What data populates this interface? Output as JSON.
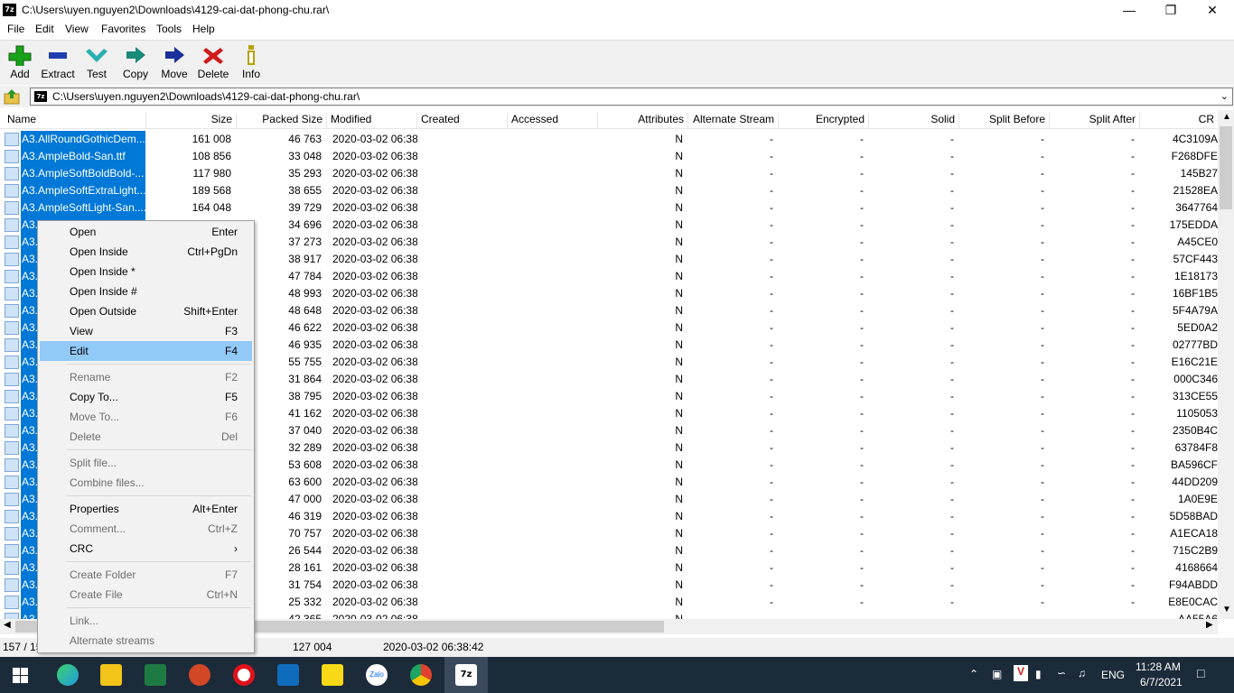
{
  "window": {
    "title": "C:\\Users\\uyen.nguyen2\\Downloads\\4129-cai-dat-phong-chu.rar\\",
    "app_icon": "7z",
    "minimize": "—",
    "maximize": "❐",
    "close": "✕"
  },
  "menu": [
    "File",
    "Edit",
    "View",
    "Favorites",
    "Tools",
    "Help"
  ],
  "toolbar": [
    {
      "label": "Add",
      "icon": "plus-icon",
      "color": "#1ba21b"
    },
    {
      "label": "Extract",
      "icon": "minus-icon",
      "color": "#1f3fb0"
    },
    {
      "label": "Test",
      "icon": "check-icon",
      "color": "#2ab0b0"
    },
    {
      "label": "Copy",
      "icon": "arrow-right-icon",
      "color": "#1a8a7a"
    },
    {
      "label": "Move",
      "icon": "arrow-right-icon",
      "color": "#1a2f9c"
    },
    {
      "label": "Delete",
      "icon": "x-icon",
      "color": "#d01a1a"
    },
    {
      "label": "Info",
      "icon": "info-icon",
      "color": "#b8a000"
    }
  ],
  "address": {
    "path": "C:\\Users\\uyen.nguyen2\\Downloads\\4129-cai-dat-phong-chu.rar\\",
    "icon": "7z"
  },
  "columns": [
    "Name",
    "Size",
    "Packed Size",
    "Modified",
    "Created",
    "Accessed",
    "Attributes",
    "Alternate Stream",
    "Encrypted",
    "Solid",
    "Split Before",
    "Split After",
    "CR"
  ],
  "rows": [
    {
      "name": "A3.AllRoundGothicDem...",
      "size": "161 008",
      "packed": "46 763",
      "crc": "4C3109A",
      "selected": true
    },
    {
      "name": "A3.AmpleBold-San.ttf",
      "size": "108 856",
      "packed": "33 048",
      "crc": "F268DFE",
      "selected": true
    },
    {
      "name": "A3.AmpleSoftBoldBold-...",
      "size": "117 980",
      "packed": "35 293",
      "crc": "145B27",
      "selected": true
    },
    {
      "name": "A3.AmpleSoftExtraLight...",
      "size": "189 568",
      "packed": "38 655",
      "crc": "21528EA",
      "selected": true
    },
    {
      "name": "A3.AmpleSoftLight-San....",
      "size": "164 048",
      "packed": "39 729",
      "crc": "3647764",
      "selected": true
    },
    {
      "name": "A3.",
      "size": "",
      "packed": "34 696",
      "crc": "175EDDA",
      "selected": true
    },
    {
      "name": "A3.",
      "size": "",
      "packed": "37 273",
      "crc": "A45CE0",
      "selected": true
    },
    {
      "name": "A3.",
      "size": "",
      "packed": "38 917",
      "crc": "57CF443",
      "selected": true
    },
    {
      "name": "A3.",
      "size": "",
      "packed": "47 784",
      "crc": "1E18173",
      "selected": true
    },
    {
      "name": "A3.",
      "size": "",
      "packed": "48 993",
      "crc": "16BF1B5",
      "selected": true
    },
    {
      "name": "A3.",
      "size": "",
      "packed": "48 648",
      "crc": "5F4A79A",
      "selected": true
    },
    {
      "name": "A3.",
      "size": "",
      "packed": "46 622",
      "crc": "5ED0A2",
      "selected": true
    },
    {
      "name": "A3.",
      "size": "",
      "packed": "46 935",
      "crc": "02777BD",
      "selected": true
    },
    {
      "name": "A3.",
      "size": "",
      "packed": "55 755",
      "crc": "E16C21E",
      "selected": true
    },
    {
      "name": "A3.",
      "size": "",
      "packed": "31 864",
      "crc": "000C346",
      "selected": true
    },
    {
      "name": "A3.",
      "size": "",
      "packed": "38 795",
      "crc": "313CE55",
      "selected": true
    },
    {
      "name": "A3.",
      "size": "",
      "packed": "41 162",
      "crc": "1105053",
      "selected": true
    },
    {
      "name": "A3.",
      "size": "",
      "packed": "37 040",
      "crc": "2350B4C",
      "selected": true
    },
    {
      "name": "A3.",
      "size": "",
      "packed": "32 289",
      "crc": "63784F8",
      "selected": true
    },
    {
      "name": "A3.",
      "size": "",
      "packed": "53 608",
      "crc": "BA596CF",
      "selected": true
    },
    {
      "name": "A3.",
      "size": "",
      "packed": "63 600",
      "crc": "44DD209",
      "selected": true
    },
    {
      "name": "A3.",
      "size": "",
      "packed": "47 000",
      "crc": "1A0E9E",
      "selected": true
    },
    {
      "name": "A3.",
      "size": "",
      "packed": "46 319",
      "crc": "5D58BAD",
      "selected": true
    },
    {
      "name": "A3.",
      "size": "",
      "packed": "70 757",
      "crc": "A1ECA18",
      "selected": true
    },
    {
      "name": "A3.",
      "size": "",
      "packed": "26 544",
      "crc": "715C2B9",
      "selected": true
    },
    {
      "name": "A3.",
      "size": "",
      "packed": "28 161",
      "crc": "4168664",
      "selected": true
    },
    {
      "name": "A3.",
      "size": "",
      "packed": "31 754",
      "crc": "F94ABDD",
      "selected": true
    },
    {
      "name": "A3.",
      "size": "",
      "packed": "25 332",
      "crc": "E8E0CAC",
      "selected": true
    },
    {
      "name": "A3.",
      "size": "",
      "packed": "42 365",
      "crc": "AA55A6",
      "selected": true
    }
  ],
  "row_defaults": {
    "modified": "2020-03-02 06:38",
    "attributes": "N",
    "dash": "-"
  },
  "context_menu": [
    {
      "label": "Open",
      "key": "Enter"
    },
    {
      "label": "Open Inside",
      "key": "Ctrl+PgDn"
    },
    {
      "label": "Open Inside *",
      "key": ""
    },
    {
      "label": "Open Inside #",
      "key": ""
    },
    {
      "label": "Open Outside",
      "key": "Shift+Enter"
    },
    {
      "label": "View",
      "key": "F3"
    },
    {
      "label": "Edit",
      "key": "F4",
      "highlight": true
    },
    {
      "sep": true
    },
    {
      "label": "Rename",
      "key": "F2",
      "disabled": true
    },
    {
      "label": "Copy To...",
      "key": "F5"
    },
    {
      "label": "Move To...",
      "key": "F6",
      "disabled": true
    },
    {
      "label": "Delete",
      "key": "Del",
      "disabled": true
    },
    {
      "sep": true
    },
    {
      "label": "Split file...",
      "key": "",
      "disabled": true
    },
    {
      "label": "Combine files...",
      "key": "",
      "disabled": true
    },
    {
      "sep": true
    },
    {
      "label": "Properties",
      "key": "Alt+Enter"
    },
    {
      "label": "Comment...",
      "key": "Ctrl+Z",
      "disabled": true
    },
    {
      "label": "CRC",
      "key": "›"
    },
    {
      "sep": true
    },
    {
      "label": "Create Folder",
      "key": "F7",
      "disabled": true
    },
    {
      "label": "Create File",
      "key": "Ctrl+N",
      "disabled": true
    },
    {
      "sep": true
    },
    {
      "label": "Link...",
      "key": "",
      "disabled": true
    },
    {
      "label": "Alternate streams",
      "key": "",
      "disabled": true
    }
  ],
  "status": {
    "selection": "157 / 15",
    "packed_total": "127 004",
    "modified": "2020-03-02 06:38:42"
  },
  "taskbar": {
    "apps": [
      {
        "name": "start-icon",
        "color": "#ffffff"
      },
      {
        "name": "edge-icon",
        "color": "#1e9be0"
      },
      {
        "name": "file-explorer-icon",
        "color": "#f2c318"
      },
      {
        "name": "excel-icon",
        "color": "#1d7a43"
      },
      {
        "name": "powerpoint-icon",
        "color": "#d24726"
      },
      {
        "name": "opera-icon",
        "color": "#e0121c"
      },
      {
        "name": "outlook-icon",
        "color": "#0f6cbd"
      },
      {
        "name": "sticky-notes-icon",
        "color": "#f7d917"
      },
      {
        "name": "zalo-icon",
        "color": "#ffffff"
      },
      {
        "name": "chrome-icon",
        "color": "#e3412f"
      },
      {
        "name": "7zip-icon",
        "color": "#ffffff"
      }
    ],
    "zalo_label": "Zalo",
    "lang": "ENG",
    "time": "11:28 AM",
    "date": "6/7/2021"
  }
}
